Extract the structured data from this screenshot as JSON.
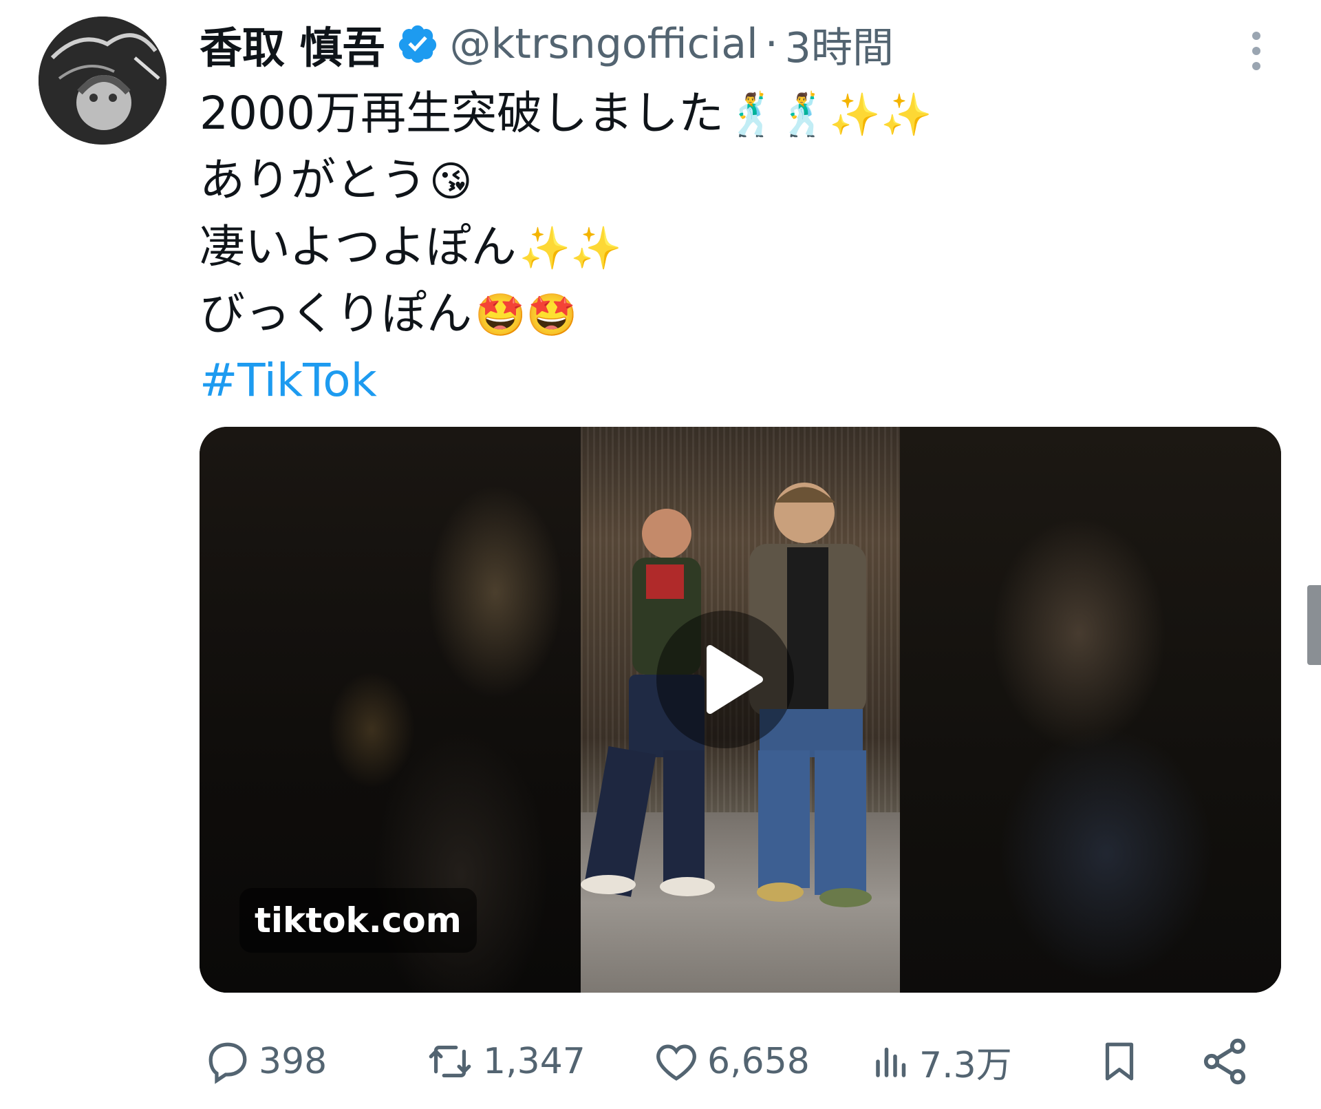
{
  "tweet": {
    "display_name": "香取 慎吾",
    "handle": "@ktrsngofficial",
    "separator": "·",
    "time": "3時間",
    "lines": [
      {
        "text": "2000万再生突破しました",
        "emoji": "🕺🕺✨✨"
      },
      {
        "text": "ありがとう",
        "emoji": "😘"
      },
      {
        "text": "凄いよつよぽん",
        "emoji": "✨✨"
      },
      {
        "text": "びっくりぽん",
        "emoji": "🤩🤩"
      }
    ],
    "hashtag": "#TikTok"
  },
  "media": {
    "source_label": "tiktok.com"
  },
  "actions": {
    "replies": "398",
    "retweets": "1,347",
    "likes": "6,658",
    "views": "7.3万"
  },
  "colors": {
    "verified": "#1d9bf0",
    "hashtag": "#1d9bf0",
    "meta_text": "#536471"
  }
}
